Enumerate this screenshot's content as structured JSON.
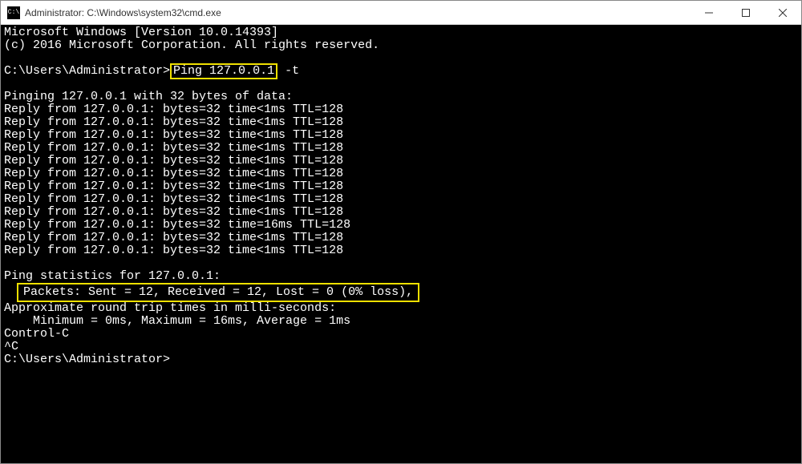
{
  "titlebar": {
    "icon_text": "C:\\",
    "title": "Administrator: C:\\Windows\\system32\\cmd.exe"
  },
  "terminal": {
    "header1": "Microsoft Windows [Version 10.0.14393]",
    "header2": "(c) 2016 Microsoft Corporation. All rights reserved.",
    "prompt_prefix": "C:\\Users\\Administrator>",
    "command_highlighted": "Ping 127.0.0.1",
    "command_suffix": " -t",
    "pinging_line": "Pinging 127.0.0.1 with 32 bytes of data:",
    "replies": [
      "Reply from 127.0.0.1: bytes=32 time<1ms TTL=128",
      "Reply from 127.0.0.1: bytes=32 time<1ms TTL=128",
      "Reply from 127.0.0.1: bytes=32 time<1ms TTL=128",
      "Reply from 127.0.0.1: bytes=32 time<1ms TTL=128",
      "Reply from 127.0.0.1: bytes=32 time<1ms TTL=128",
      "Reply from 127.0.0.1: bytes=32 time<1ms TTL=128",
      "Reply from 127.0.0.1: bytes=32 time<1ms TTL=128",
      "Reply from 127.0.0.1: bytes=32 time<1ms TTL=128",
      "Reply from 127.0.0.1: bytes=32 time<1ms TTL=128",
      "Reply from 127.0.0.1: bytes=32 time=16ms TTL=128",
      "Reply from 127.0.0.1: bytes=32 time<1ms TTL=128",
      "Reply from 127.0.0.1: bytes=32 time<1ms TTL=128"
    ],
    "stats_header": "Ping statistics for 127.0.0.1:",
    "stats_packets": "Packets: Sent = 12, Received = 12, Lost = 0 (0% loss),",
    "rtt_header": "Approximate round trip times in milli-seconds:",
    "rtt_values": "    Minimum = 0ms, Maximum = 16ms, Average = 1ms",
    "control_c": "Control-C",
    "caret_c": "^C",
    "final_prompt": "C:\\Users\\Administrator>"
  }
}
